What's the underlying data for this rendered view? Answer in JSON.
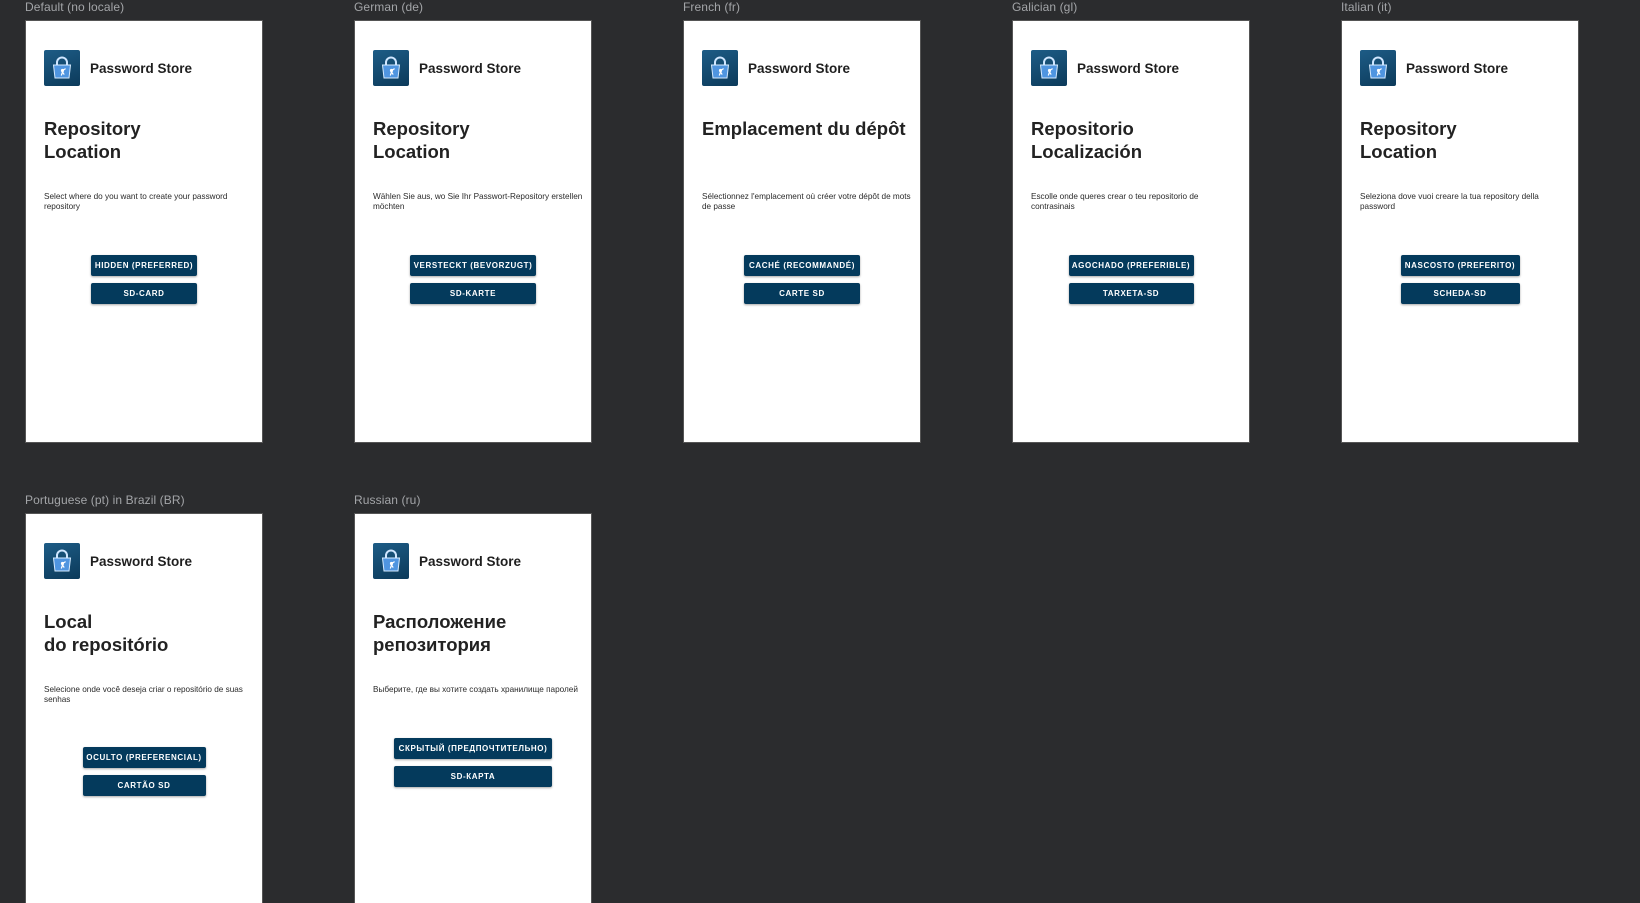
{
  "app": {
    "name": "Password Store",
    "icon": "shopping-bag-lock-icon"
  },
  "colors": {
    "background": "#2b2c2e",
    "phone_background": "#ffffff",
    "button": "#043a5c",
    "label": "#a3a5a8"
  },
  "previews": [
    {
      "locale_label": "Default (no locale)",
      "title": "Repository\nLocation",
      "description": "Select where do you want to create your password repository",
      "hidden_button": "HIDDEN (PREFERRED)",
      "sdcard_button": "SD-CARD"
    },
    {
      "locale_label": "German (de)",
      "title": "Repository\nLocation",
      "description": "Wählen Sie aus, wo Sie Ihr Passwort-Repository erstellen möchten",
      "hidden_button": "VERSTECKT (BEVORZUGT)",
      "sdcard_button": "SD-KARTE"
    },
    {
      "locale_label": "French (fr)",
      "title": "Emplacement du dépôt",
      "description": "Sélectionnez l'emplacement où créer votre dépôt de mots de passe",
      "hidden_button": "CACHÉ (RECOMMANDÉ)",
      "sdcard_button": "CARTE SD"
    },
    {
      "locale_label": "Galician (gl)",
      "title": "Repositorio\nLocalización",
      "description": "Escolle onde queres crear o teu repositorio de contrasinais",
      "hidden_button": "AGOCHADO (PREFERIBLE)",
      "sdcard_button": "TARXETA-SD"
    },
    {
      "locale_label": "Italian (it)",
      "title": "Repository\nLocation",
      "description": "Seleziona dove vuoi creare la tua repository della password",
      "hidden_button": "NASCOSTO (PREFERITO)",
      "sdcard_button": "SCHEDA-SD"
    },
    {
      "locale_label": "Portuguese (pt) in Brazil (BR)",
      "title": "Local\ndo repositório",
      "description": "Selecione onde você deseja criar o repositório de suas senhas",
      "hidden_button": "OCULTO (PREFERENCIAL)",
      "sdcard_button": "CARTÃO SD"
    },
    {
      "locale_label": "Russian (ru)",
      "title": "Расположение\nрепозитория",
      "description": "Выберите, где вы хотите создать хранилище паролей",
      "hidden_button": "СКРЫТЫЙ (ПРЕДПОЧТИТЕЛЬНО)",
      "sdcard_button": "SD-КАРТА"
    }
  ]
}
